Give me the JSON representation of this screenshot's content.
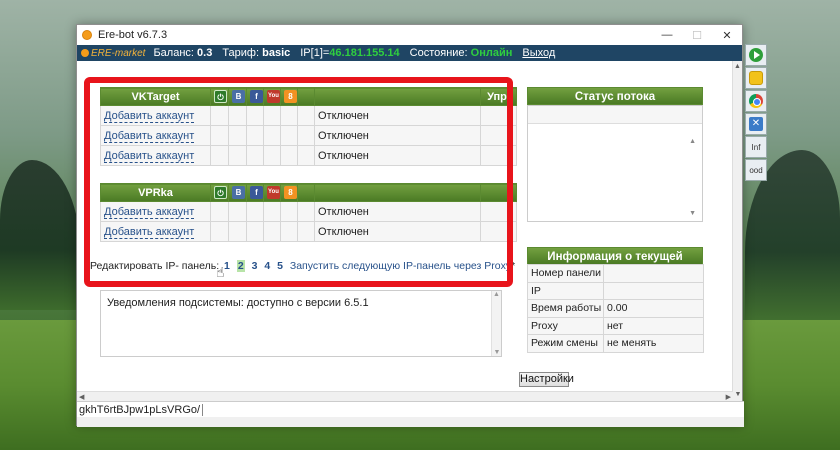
{
  "window": {
    "title": "Ere-bot v6.7.3",
    "controls": {
      "minimize": "—",
      "maximize": "☐",
      "close": "✕"
    }
  },
  "statusbar": {
    "logo": "ERE-market",
    "balance_label": "Баланс:",
    "balance_value": "0.3",
    "tariff_label": "Тариф:",
    "tariff_value": "basic",
    "ip_label": "IP[1]=",
    "ip_value": "46.181.155.14",
    "state_label": "Состояние:",
    "state_value": "Онлайн",
    "exit": "Выход"
  },
  "vktarget": {
    "title": "VKTarget",
    "manage_header": "Упр.",
    "rows": [
      {
        "account": "Добавить аккаунт",
        "status": "Отключен"
      },
      {
        "account": "Добавить аккаунт",
        "status": "Отключен"
      },
      {
        "account": "Добавить аккаунт",
        "status": "Отключен"
      }
    ]
  },
  "vprka": {
    "title": "VPRka",
    "rows": [
      {
        "account": "Добавить аккаунт",
        "status": "Отключен"
      },
      {
        "account": "Добавить аккаунт",
        "status": "Отключен"
      }
    ]
  },
  "icons": {
    "power": "⏻",
    "vk": "B",
    "fb": "f",
    "yt": "You",
    "ok": "8"
  },
  "ip_panel": {
    "label": "Редактировать IP- панель:",
    "numbers": [
      "1",
      "2",
      "3",
      "4",
      "5"
    ],
    "active_index": 1,
    "next_link": "Запустить следующую IP-панель через Proxy",
    "next_mark": "*"
  },
  "notification": "Уведомления подсистемы: доступно с версии 6.5.1",
  "stream_status": {
    "title": "Статус потока"
  },
  "panel_info": {
    "title": "Информация о текущей панели",
    "rows": [
      {
        "label": "Номер панели",
        "value": ""
      },
      {
        "label": "IP",
        "value": ""
      },
      {
        "label": "Время работы",
        "value": "0.00"
      },
      {
        "label": "Proxy",
        "value": "нет"
      },
      {
        "label": "Режим смены",
        "value": "не менять"
      }
    ]
  },
  "settings_button": "Настройки",
  "address_bar": "gkhT6rtBJpw1pLsVRGo/",
  "side_buttons": {
    "inf": "Inf",
    "ood": "ood"
  }
}
